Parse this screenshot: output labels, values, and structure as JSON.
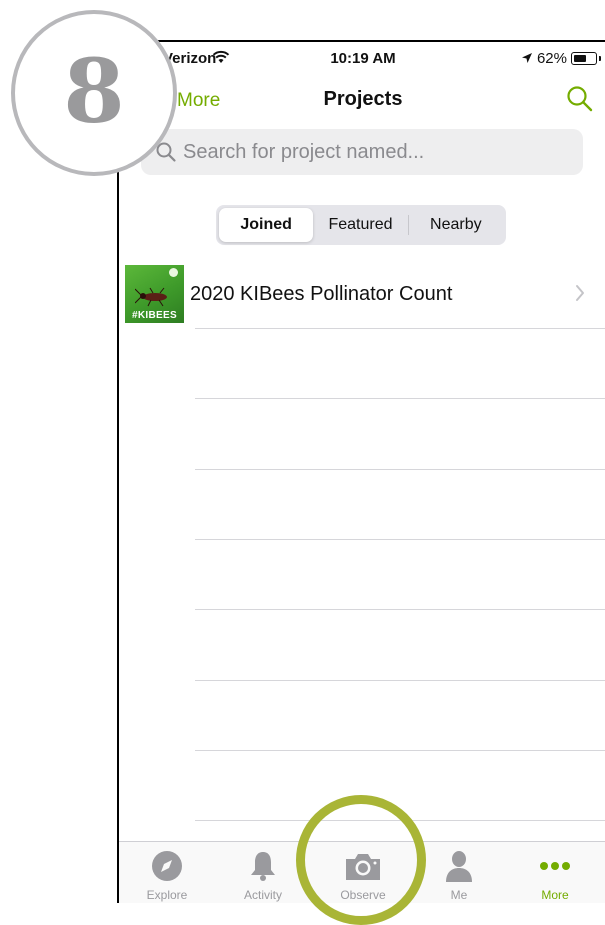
{
  "status_bar": {
    "carrier": "Verizon",
    "time": "10:19 AM",
    "battery_percent": "62%",
    "battery_level": 0.62
  },
  "nav": {
    "back_label": "More",
    "title": "Projects",
    "search_icon": "search-icon"
  },
  "search": {
    "placeholder": "Search for project named..."
  },
  "segments": [
    {
      "label": "Joined",
      "active": true
    },
    {
      "label": "Featured",
      "active": false
    },
    {
      "label": "Nearby",
      "active": false
    }
  ],
  "projects": [
    {
      "name": "2020 KIBees Pollinator Count",
      "thumb_tag": "#KIBEES"
    }
  ],
  "tabs": [
    {
      "label": "Explore",
      "icon": "compass-icon",
      "active": false
    },
    {
      "label": "Activity",
      "icon": "bell-icon",
      "active": false
    },
    {
      "label": "Observe",
      "icon": "camera-icon",
      "active": false
    },
    {
      "label": "Me",
      "icon": "person-icon",
      "active": false
    },
    {
      "label": "More",
      "icon": "more-dots-icon",
      "active": true
    }
  ],
  "step_badge": "8",
  "colors": {
    "accent": "#74ac00",
    "badge_ring": "#b8b8bb",
    "observe_ring": "#a9b536"
  }
}
